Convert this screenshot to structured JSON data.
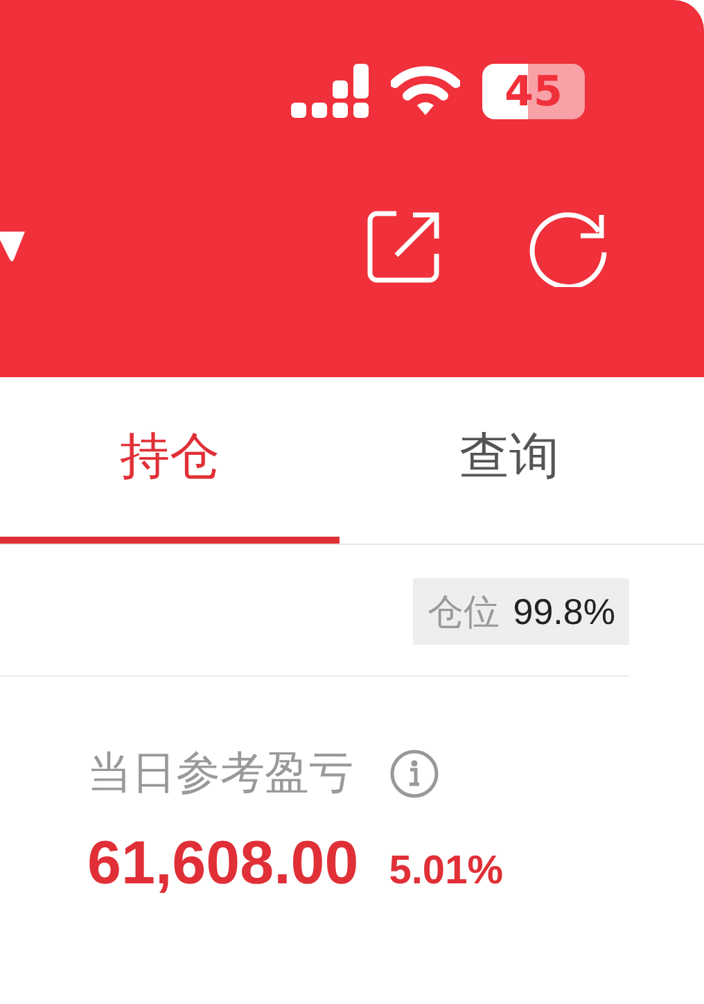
{
  "status_bar": {
    "battery": "45"
  },
  "tabs": [
    {
      "label": "持仓",
      "selected": true
    },
    {
      "label": "查询",
      "selected": false
    }
  ],
  "position": {
    "label": "仓位",
    "value": "99.8%"
  },
  "profit": {
    "label": "当日参考盈亏",
    "amount": "61,608.00",
    "percent": "5.01%"
  }
}
